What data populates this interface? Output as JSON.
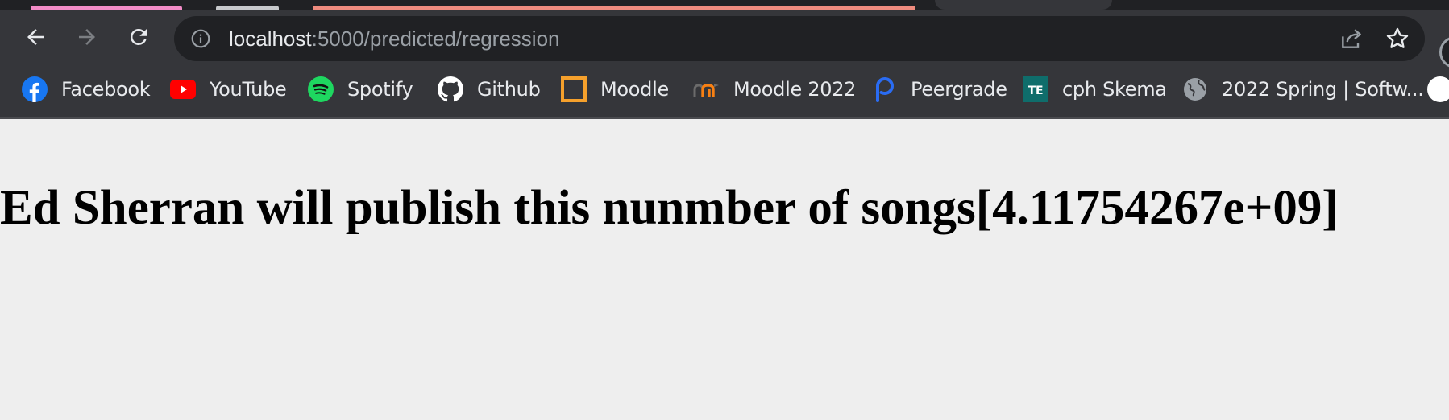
{
  "browser": {
    "tab_colors": [
      "#f28cc7",
      "#c7c9cc",
      "#ee8b7e"
    ],
    "nav": {
      "back_icon": "back-arrow-icon",
      "forward_icon": "forward-arrow-icon",
      "reload_icon": "reload-icon"
    },
    "address_bar": {
      "info_icon": "site-info-icon",
      "host": "localhost",
      "path": ":5000/predicted/regression",
      "share_icon": "share-icon",
      "bookmark_icon": "star-icon"
    },
    "bookmarks": [
      {
        "label": "Facebook",
        "icon": "facebook-icon",
        "color": "#1877f2"
      },
      {
        "label": "YouTube",
        "icon": "youtube-icon",
        "color": "#ff0000"
      },
      {
        "label": "Spotify",
        "icon": "spotify-icon",
        "color": "#1ed760"
      },
      {
        "label": "Github",
        "icon": "github-icon",
        "color": "#ffffff"
      },
      {
        "label": "Moodle",
        "icon": "moodle-square-icon",
        "color": "#f6a12c"
      },
      {
        "label": "Moodle 2022",
        "icon": "moodle-logo-icon",
        "color": "#f98012"
      },
      {
        "label": "Peergrade",
        "icon": "peergrade-icon",
        "color": "#2a6cf3"
      },
      {
        "label": "cph Skema",
        "icon": "te-icon",
        "icon_text": "TE",
        "color": "#0f6d6b"
      },
      {
        "label": "2022 Spring | Softw...",
        "icon": "globe-icon",
        "color": "#9aa0a6"
      }
    ]
  },
  "page": {
    "headline": "Ed Sherran will publish this nunmber of songs[4.11754267e+09]"
  }
}
